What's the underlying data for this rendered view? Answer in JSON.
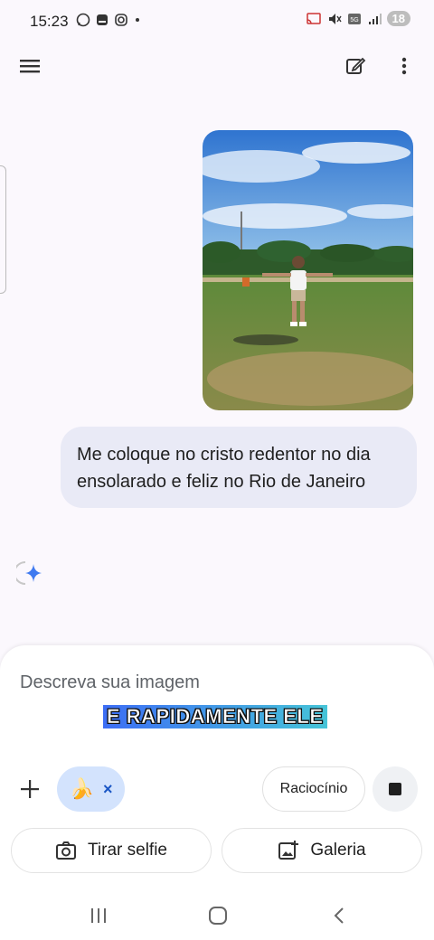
{
  "status_bar": {
    "time": "15:23",
    "left_icons": [
      "whatsapp-icon",
      "notification-icon",
      "instagram-icon",
      "dot-icon"
    ],
    "right_icons": [
      "cast-icon",
      "mute-icon",
      "5g-icon",
      "signal-icon"
    ],
    "battery": "18"
  },
  "top_bar": {
    "menu_icon": "menu-icon",
    "new_chat_icon": "edit-icon",
    "more_icon": "more-vert-icon"
  },
  "chat": {
    "user_message": "Me coloque no cristo redentor no dia ensolarado e feliz no Rio de Janeiro",
    "response_icon": "gemini-spark-icon"
  },
  "composer": {
    "placeholder": "Descreva sua imagem",
    "caption_overlay": "E RAPIDAMENTE ELE",
    "chip_emoji": "🍌",
    "chip_close": "×",
    "reasoning_label": "Raciocínio",
    "selfie_label": "Tirar selfie",
    "gallery_label": "Galeria"
  },
  "colors": {
    "background": "#fbf8fd",
    "bubble": "#e9eaf6",
    "chip": "#d3e3fd",
    "accent": "#1a56c5"
  }
}
